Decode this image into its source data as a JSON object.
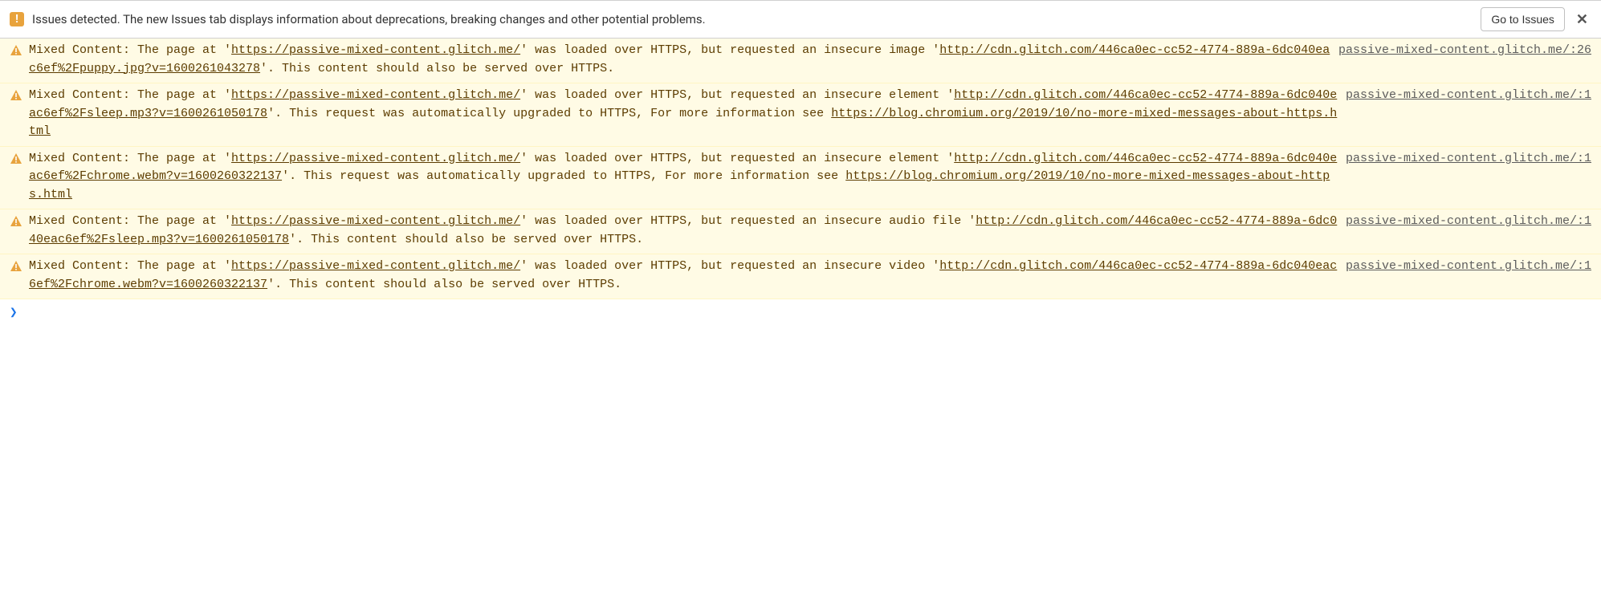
{
  "issuesBar": {
    "text": "Issues detected. The new Issues tab displays information about deprecations, breaking changes and other potential problems.",
    "button": "Go to Issues",
    "close": "✕"
  },
  "warnings": [
    {
      "source": "passive-mixed-content.glitch.me/:26",
      "pre1": "Mixed Content: The page at '",
      "link1": "https://passive-mixed-content.glitch.me/",
      "mid1": "' was loaded over HTTPS, but requested an insecure image '",
      "link2": "http://cdn.glitch.com/446ca0ec-cc52-4774-889a-6dc040eac6ef%2Fpuppy.jpg?v=1600261043278",
      "mid2": "'. This content should also be served over HTTPS.",
      "link3": "",
      "tail": ""
    },
    {
      "source": "passive-mixed-content.glitch.me/:1",
      "pre1": "Mixed Content: The page at '",
      "link1": "https://passive-mixed-content.glitch.me/",
      "mid1": "' was loaded over HTTPS, but requested an insecure element '",
      "link2": "http://cdn.glitch.com/446ca0ec-cc52-4774-889a-6dc040eac6ef%2Fsleep.mp3?v=1600261050178",
      "mid2": "'. This request was automatically upgraded to HTTPS, For more information see ",
      "link3": "https://blog.chromium.org/2019/10/no-more-mixed-messages-about-https.html",
      "tail": ""
    },
    {
      "source": "passive-mixed-content.glitch.me/:1",
      "pre1": "Mixed Content: The page at '",
      "link1": "https://passive-mixed-content.glitch.me/",
      "mid1": "' was loaded over HTTPS, but requested an insecure element '",
      "link2": "http://cdn.glitch.com/446ca0ec-cc52-4774-889a-6dc040eac6ef%2Fchrome.webm?v=1600260322137",
      "mid2": "'. This request was automatically upgraded to HTTPS, For more information see ",
      "link3": "https://blog.chromium.org/2019/10/no-more-mixed-messages-about-https.html",
      "tail": ""
    },
    {
      "source": "passive-mixed-content.glitch.me/:1",
      "pre1": "Mixed Content: The page at '",
      "link1": "https://passive-mixed-content.glitch.me/",
      "mid1": "' was loaded over HTTPS, but requested an insecure audio file '",
      "link2": "http://cdn.glitch.com/446ca0ec-cc52-4774-889a-6dc040eac6ef%2Fsleep.mp3?v=1600261050178",
      "mid2": "'. This content should also be served over HTTPS.",
      "link3": "",
      "tail": ""
    },
    {
      "source": "passive-mixed-content.glitch.me/:1",
      "pre1": "Mixed Content: The page at '",
      "link1": "https://passive-mixed-content.glitch.me/",
      "mid1": "' was loaded over HTTPS, but requested an insecure video '",
      "link2": "http://cdn.glitch.com/446ca0ec-cc52-4774-889a-6dc040eac6ef%2Fchrome.webm?v=1600260322137",
      "mid2": "'. This content should also be served over HTTPS.",
      "link3": "",
      "tail": ""
    }
  ],
  "prompt": "❯"
}
